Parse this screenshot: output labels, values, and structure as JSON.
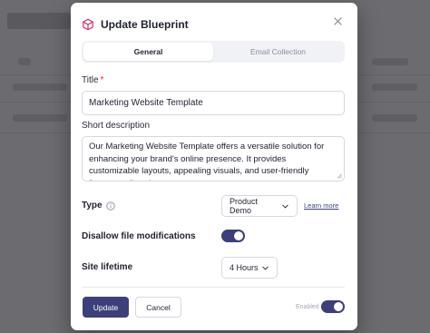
{
  "modal": {
    "title": "Update Blueprint",
    "icon": "cube-icon",
    "accent_color": "#3d3f7a",
    "icon_color": "#d6336c"
  },
  "tabs": [
    {
      "label": "General",
      "active": true
    },
    {
      "label": "Email Collection",
      "active": false
    }
  ],
  "title_field": {
    "label": "Title",
    "required_marker": "*",
    "value": "Marketing Website Template"
  },
  "description_field": {
    "label": "Short description",
    "value": "Our Marketing Website Template offers a versatile solution for enhancing your brand's online presence. It provides customizable layouts, appealing visuals, and user-friendly features tailored to"
  },
  "type_row": {
    "label": "Type",
    "selected": "Product Demo",
    "learn_more": "Learn more"
  },
  "disallow_row": {
    "label": "Disallow file modifications",
    "enabled": true
  },
  "lifetime_row": {
    "label": "Site lifetime",
    "selected": "4 Hours"
  },
  "footer": {
    "update_label": "Update",
    "cancel_label": "Cancel",
    "enabled_label": "Enabled",
    "enabled": true
  }
}
